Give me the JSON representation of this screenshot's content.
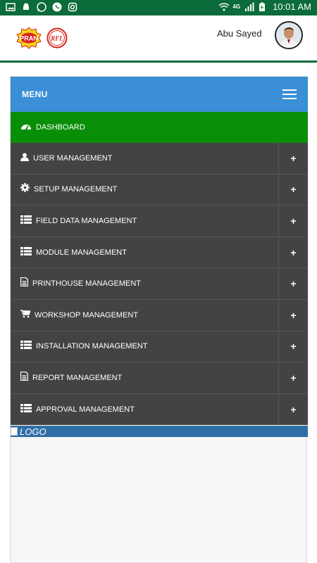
{
  "status_bar": {
    "network": "4G",
    "time": "10:01 AM"
  },
  "header": {
    "logos": [
      "PRAN",
      "RFL"
    ],
    "user_name": "Abu Sayed"
  },
  "menu": {
    "title": "MENU",
    "dashboard_label": "DASHBOARD",
    "items": [
      {
        "label": "USER MANAGEMENT",
        "icon": "user-icon"
      },
      {
        "label": "SETUP MANAGEMENT",
        "icon": "gear-icon"
      },
      {
        "label": "FIELD DATA MANAGEMENT",
        "icon": "list-icon"
      },
      {
        "label": "MODULE MANAGEMENT",
        "icon": "list-icon"
      },
      {
        "label": "PRINTHOUSE MANAGEMENT",
        "icon": "document-icon"
      },
      {
        "label": "WORKSHOP MANAGEMENT",
        "icon": "cart-icon"
      },
      {
        "label": "INSTALLATION MANAGEMENT",
        "icon": "list-icon"
      },
      {
        "label": "REPORT MANAGEMENT",
        "icon": "document-icon"
      },
      {
        "label": "APPROVAL MANAGEMENT",
        "icon": "list-icon"
      }
    ],
    "expand_symbol": "+",
    "logo_alt": "LOGO"
  }
}
